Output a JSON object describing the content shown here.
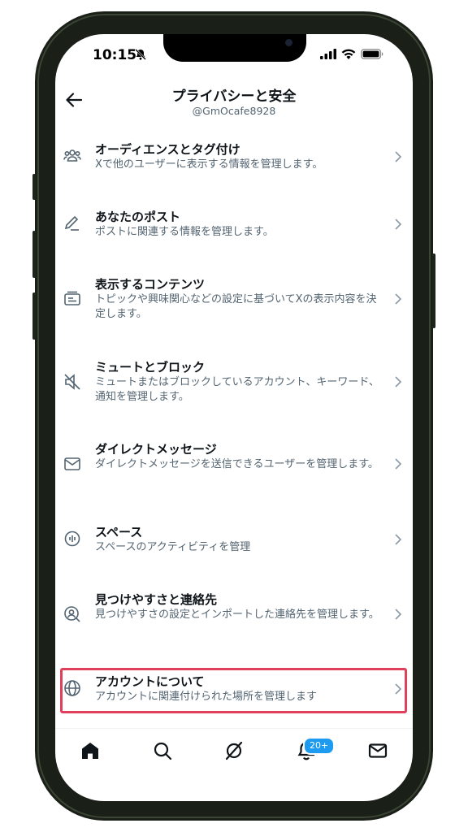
{
  "status": {
    "time": "10:15"
  },
  "header": {
    "title": "プライバシーと安全",
    "handle": "@GmOcafe8928",
    "back_icon": "back-arrow-icon"
  },
  "items": [
    {
      "icon": "people-icon",
      "label": "オーディエンスとタグ付け",
      "description": "Xで他のユーザーに表示する情報を管理します。"
    },
    {
      "icon": "pencil-icon",
      "label": "あなたのポスト",
      "description": "ポストに関連する情報を管理します。"
    },
    {
      "icon": "content-icon",
      "label": "表示するコンテンツ",
      "description": "トピックや興味関心などの設定に基づいてXの表示内容を決定します。"
    },
    {
      "icon": "mute-icon",
      "label": "ミュートとブロック",
      "description": "ミュートまたはブロックしているアカウント、キーワード、通知を管理します。"
    },
    {
      "icon": "envelope-icon",
      "label": "ダイレクトメッセージ",
      "description": "ダイレクトメッセージを送信できるユーザーを管理します。"
    },
    {
      "icon": "spaces-icon",
      "label": "スペース",
      "description": "スペースのアクティビティを管理"
    },
    {
      "icon": "find-contacts-icon",
      "label": "見つけやすさと連絡先",
      "description": "見つけやすさの設定とインポートした連絡先を管理します。"
    },
    {
      "icon": "globe-icon",
      "label": "アカウントについて",
      "description": "アカウントに関連付けられた場所を管理します"
    }
  ],
  "tabbar": {
    "tabs": [
      "home-icon",
      "search-icon",
      "grok-icon",
      "notifications-icon",
      "messages-icon"
    ],
    "notification_badge": "20+"
  },
  "colors": {
    "highlight_border": "#e0405c",
    "accent": "#1d9bf0",
    "phone_frame": "#1a1f18"
  }
}
